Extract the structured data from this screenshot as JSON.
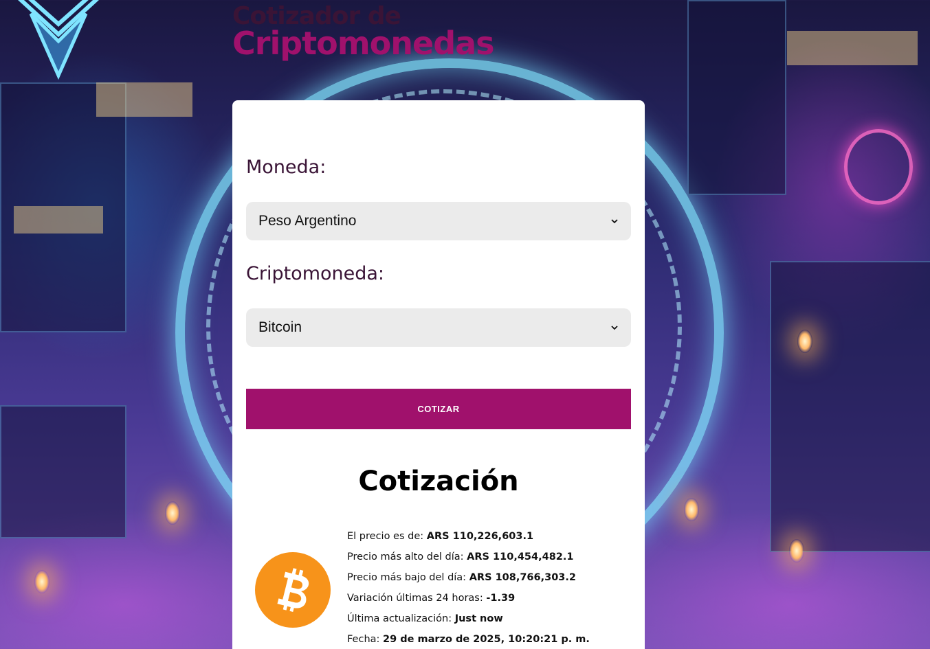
{
  "header": {
    "title_line1": "Cotizador de",
    "title_line2": "Criptomonedas"
  },
  "form": {
    "currency_label": "Moneda:",
    "currency_selected": "Peso Argentino",
    "crypto_label": "Criptomoneda:",
    "crypto_selected": "Bitcoin",
    "submit_label": "COTIZAR"
  },
  "result": {
    "heading": "Cotización",
    "coin_icon": "bitcoin-logo-icon",
    "rows": [
      {
        "label": "El precio es de: ",
        "value": "ARS 110,226,603.1"
      },
      {
        "label": "Precio más alto del día: ",
        "value": "ARS 110,454,482.1"
      },
      {
        "label": "Precio más bajo del día: ",
        "value": "ARS 108,766,303.2"
      },
      {
        "label": "Variación últimas 24 horas: ",
        "value": "-1.39"
      },
      {
        "label": "Última actualización: ",
        "value": "Just now"
      },
      {
        "label": "Fecha: ",
        "value": "29 de marzo de 2025, 10:20:21 p. m."
      }
    ]
  },
  "colors": {
    "brand": "#a0116c",
    "title_dark": "#3a1436",
    "select_bg": "#ebebeb",
    "bitcoin_orange": "#f7931a"
  }
}
